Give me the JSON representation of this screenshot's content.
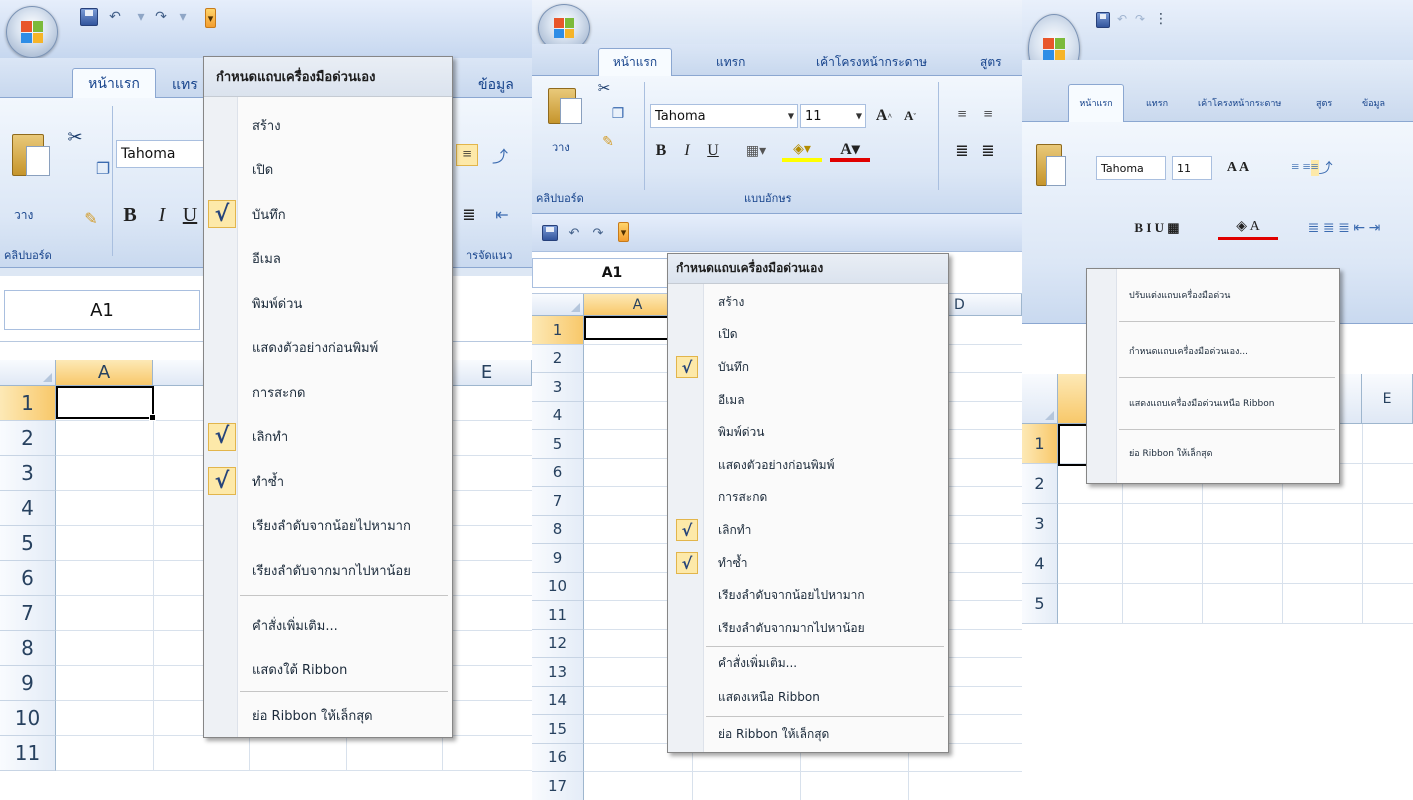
{
  "panels": [
    {
      "tabs": [
        "หน้าแรก",
        "แทร",
        "ข้อมูล"
      ],
      "font_name": "Tahoma",
      "paste_label": "วาง",
      "group_labels": [
        "คลิปบอร์ด",
        "ารจัดแนว"
      ],
      "name_box": "A1",
      "columns": [
        "A",
        "E"
      ],
      "rows": [
        "1",
        "2",
        "3",
        "4",
        "5",
        "6",
        "7",
        "8",
        "9",
        "10",
        "11"
      ],
      "menu": {
        "title": "กำหนดแถบเครื่องมือด่วนเอง",
        "items": [
          {
            "label": "สร้าง",
            "checked": false
          },
          {
            "label": "เปิด",
            "checked": false
          },
          {
            "label": "บันทึก",
            "checked": true
          },
          {
            "label": "อีเมล",
            "checked": false
          },
          {
            "label": "พิมพ์ด่วน",
            "checked": false
          },
          {
            "label": "แสดงตัวอย่างก่อนพิมพ์",
            "checked": false
          },
          {
            "label": "การสะกด",
            "checked": false
          },
          {
            "label": "เลิกทำ",
            "checked": true
          },
          {
            "label": "ทำซ้ำ",
            "checked": true
          },
          {
            "label": "เรียงลำดับจากน้อยไปหามาก",
            "checked": false
          },
          {
            "label": "เรียงลำดับจากมากไปหาน้อย",
            "checked": false
          }
        ],
        "more_commands": "คำสั่งเพิ่มเติม...",
        "show_below": "แสดงใต้ Ribbon",
        "minimize": "ย่อ Ribbon ให้เล็กสุด"
      }
    },
    {
      "tabs": [
        "หน้าแรก",
        "แทรก",
        "เค้าโครงหน้ากระดาษ",
        "สูตร"
      ],
      "font_name": "Tahoma",
      "font_size": "11",
      "paste_label": "วาง",
      "group_labels": [
        "คลิปบอร์ด",
        "แบบอักษร"
      ],
      "name_box": "A1",
      "columns": [
        "A",
        "D"
      ],
      "rows": [
        "1",
        "2",
        "3",
        "4",
        "5",
        "6",
        "7",
        "8",
        "9",
        "10",
        "11",
        "12",
        "13",
        "14",
        "15",
        "16",
        "17"
      ],
      "menu": {
        "title": "กำหนดแถบเครื่องมือด่วนเอง",
        "items": [
          {
            "label": "สร้าง",
            "checked": false
          },
          {
            "label": "เปิด",
            "checked": false
          },
          {
            "label": "บันทึก",
            "checked": true
          },
          {
            "label": "อีเมล",
            "checked": false
          },
          {
            "label": "พิมพ์ด่วน",
            "checked": false
          },
          {
            "label": "แสดงตัวอย่างก่อนพิมพ์",
            "checked": false
          },
          {
            "label": "การสะกด",
            "checked": false
          },
          {
            "label": "เลิกทำ",
            "checked": true
          },
          {
            "label": "ทำซ้ำ",
            "checked": true
          },
          {
            "label": "เรียงลำดับจากน้อยไปหามาก",
            "checked": false
          },
          {
            "label": "เรียงลำดับจากมากไปหาน้อย",
            "checked": false
          }
        ],
        "more_commands": "คำสั่งเพิ่มเติม...",
        "show_above": "แสดงเหนือ Ribbon",
        "minimize": "ย่อ Ribbon ให้เล็กสุด"
      }
    },
    {
      "tabs": [
        "หน้าแรก",
        "แทรก",
        "เค้าโครงหน้ากระดาษ",
        "สูตร",
        "ข้อมูล"
      ],
      "font_name": "Tahoma",
      "font_size": "11",
      "columns": [
        "E"
      ],
      "rows": [
        "1",
        "2",
        "3",
        "4",
        "5"
      ],
      "menu": {
        "items": [
          "ปรับแต่งแถบเครื่องมือด่วน",
          "กำหนดแถบเครื่องมือด่วนเอง...",
          "แสดงแถบเครื่องมือด่วนเหนือ Ribbon",
          "ย่อ Ribbon ให้เล็กสุด"
        ]
      }
    }
  ],
  "colors": {
    "ribbon_text": "#15428b",
    "check_bg": "#fde9a9",
    "qat_more": "#f39d2f"
  },
  "icons": [
    "office-button-icon",
    "save-icon",
    "undo-icon",
    "redo-icon",
    "customize-qat-icon",
    "paste-icon",
    "cut-icon",
    "copy-icon",
    "format-painter-icon",
    "check-icon"
  ]
}
